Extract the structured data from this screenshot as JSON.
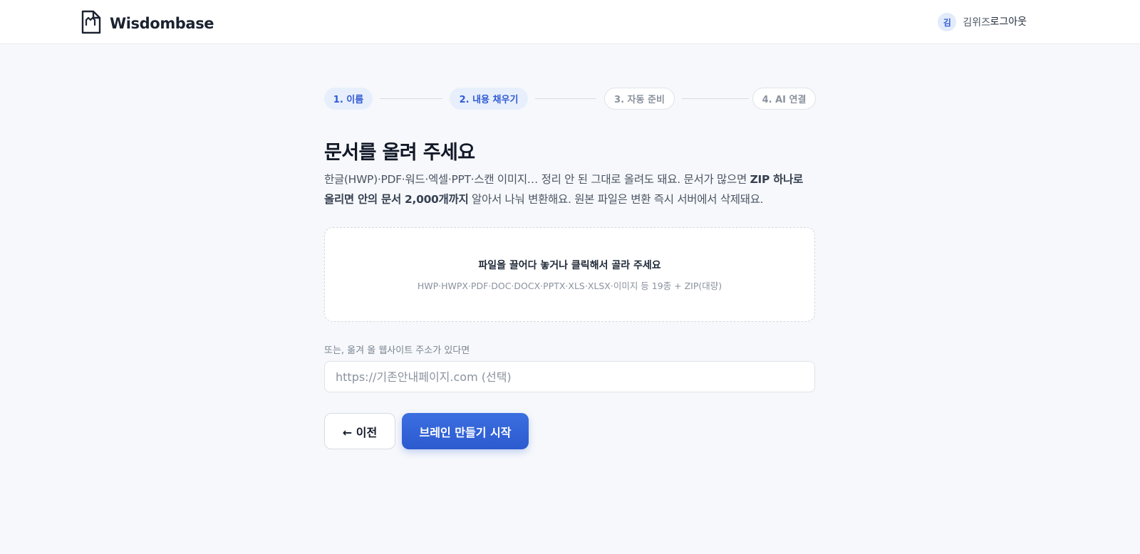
{
  "header": {
    "brand": "Wisdombase",
    "user": {
      "initial": "김",
      "name": "김위즈"
    },
    "logout_label": "로그아웃"
  },
  "steps": [
    {
      "label": "1. 이름",
      "state": "active"
    },
    {
      "label": "2. 내용 채우기",
      "state": "active"
    },
    {
      "label": "3. 자동 준비",
      "state": "pending"
    },
    {
      "label": "4. AI 연결",
      "state": "pending"
    }
  ],
  "upload": {
    "title": "문서를 올려 주세요",
    "desc_part1": "한글(HWP)·PDF·워드·엑셀·PPT·스캔 이미지… 정리 안 된 그대로 올려도 돼요. 문서가 많으면 ",
    "desc_bold": "ZIP 하나로 올리면 안의 문서 2,000개까지",
    "desc_part2": " 알아서 나눠 변환해요. 원본 파일은 변환 즉시 서버에서 삭제돼요.",
    "dropzone_title": "파일을 끌어다 놓거나 클릭해서 골라 주세요",
    "dropzone_formats": "HWP·HWPX·PDF·DOC·DOCX·PPTX·XLS·XLSX·이미지 등 19종 + ZIP(대량)",
    "url_label": "또는, 옮겨 올 웹사이트 주소가 있다면",
    "url_value": "",
    "url_placeholder": "https://기존안내페이지.com (선택)"
  },
  "actions": {
    "prev_label": "← 이전",
    "start_label": "브레인 만들기 시작"
  },
  "colors": {
    "accent": "#2f5bd3",
    "step_active_bg": "#e8effc",
    "background": "#f6f8fb"
  },
  "icons": {
    "brand_logo": "document-logo-icon"
  }
}
